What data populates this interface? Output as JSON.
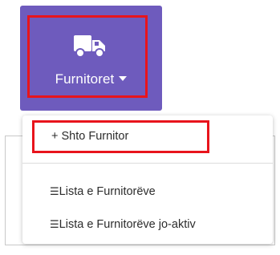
{
  "nav": {
    "label": "Furnitoret",
    "icon": "truck-icon",
    "caret_icon": "caret-down-icon",
    "bg_color": "#6e5bbd",
    "highlight_color": "#e8141c"
  },
  "dropdown": {
    "items": [
      {
        "label": "+ Shto Furnitor"
      },
      {
        "icon": "☰",
        "label": "Lista e Furnitorëve"
      },
      {
        "icon": "☰",
        "label": "Lista e Furnitorëve jo-aktiv"
      }
    ]
  }
}
